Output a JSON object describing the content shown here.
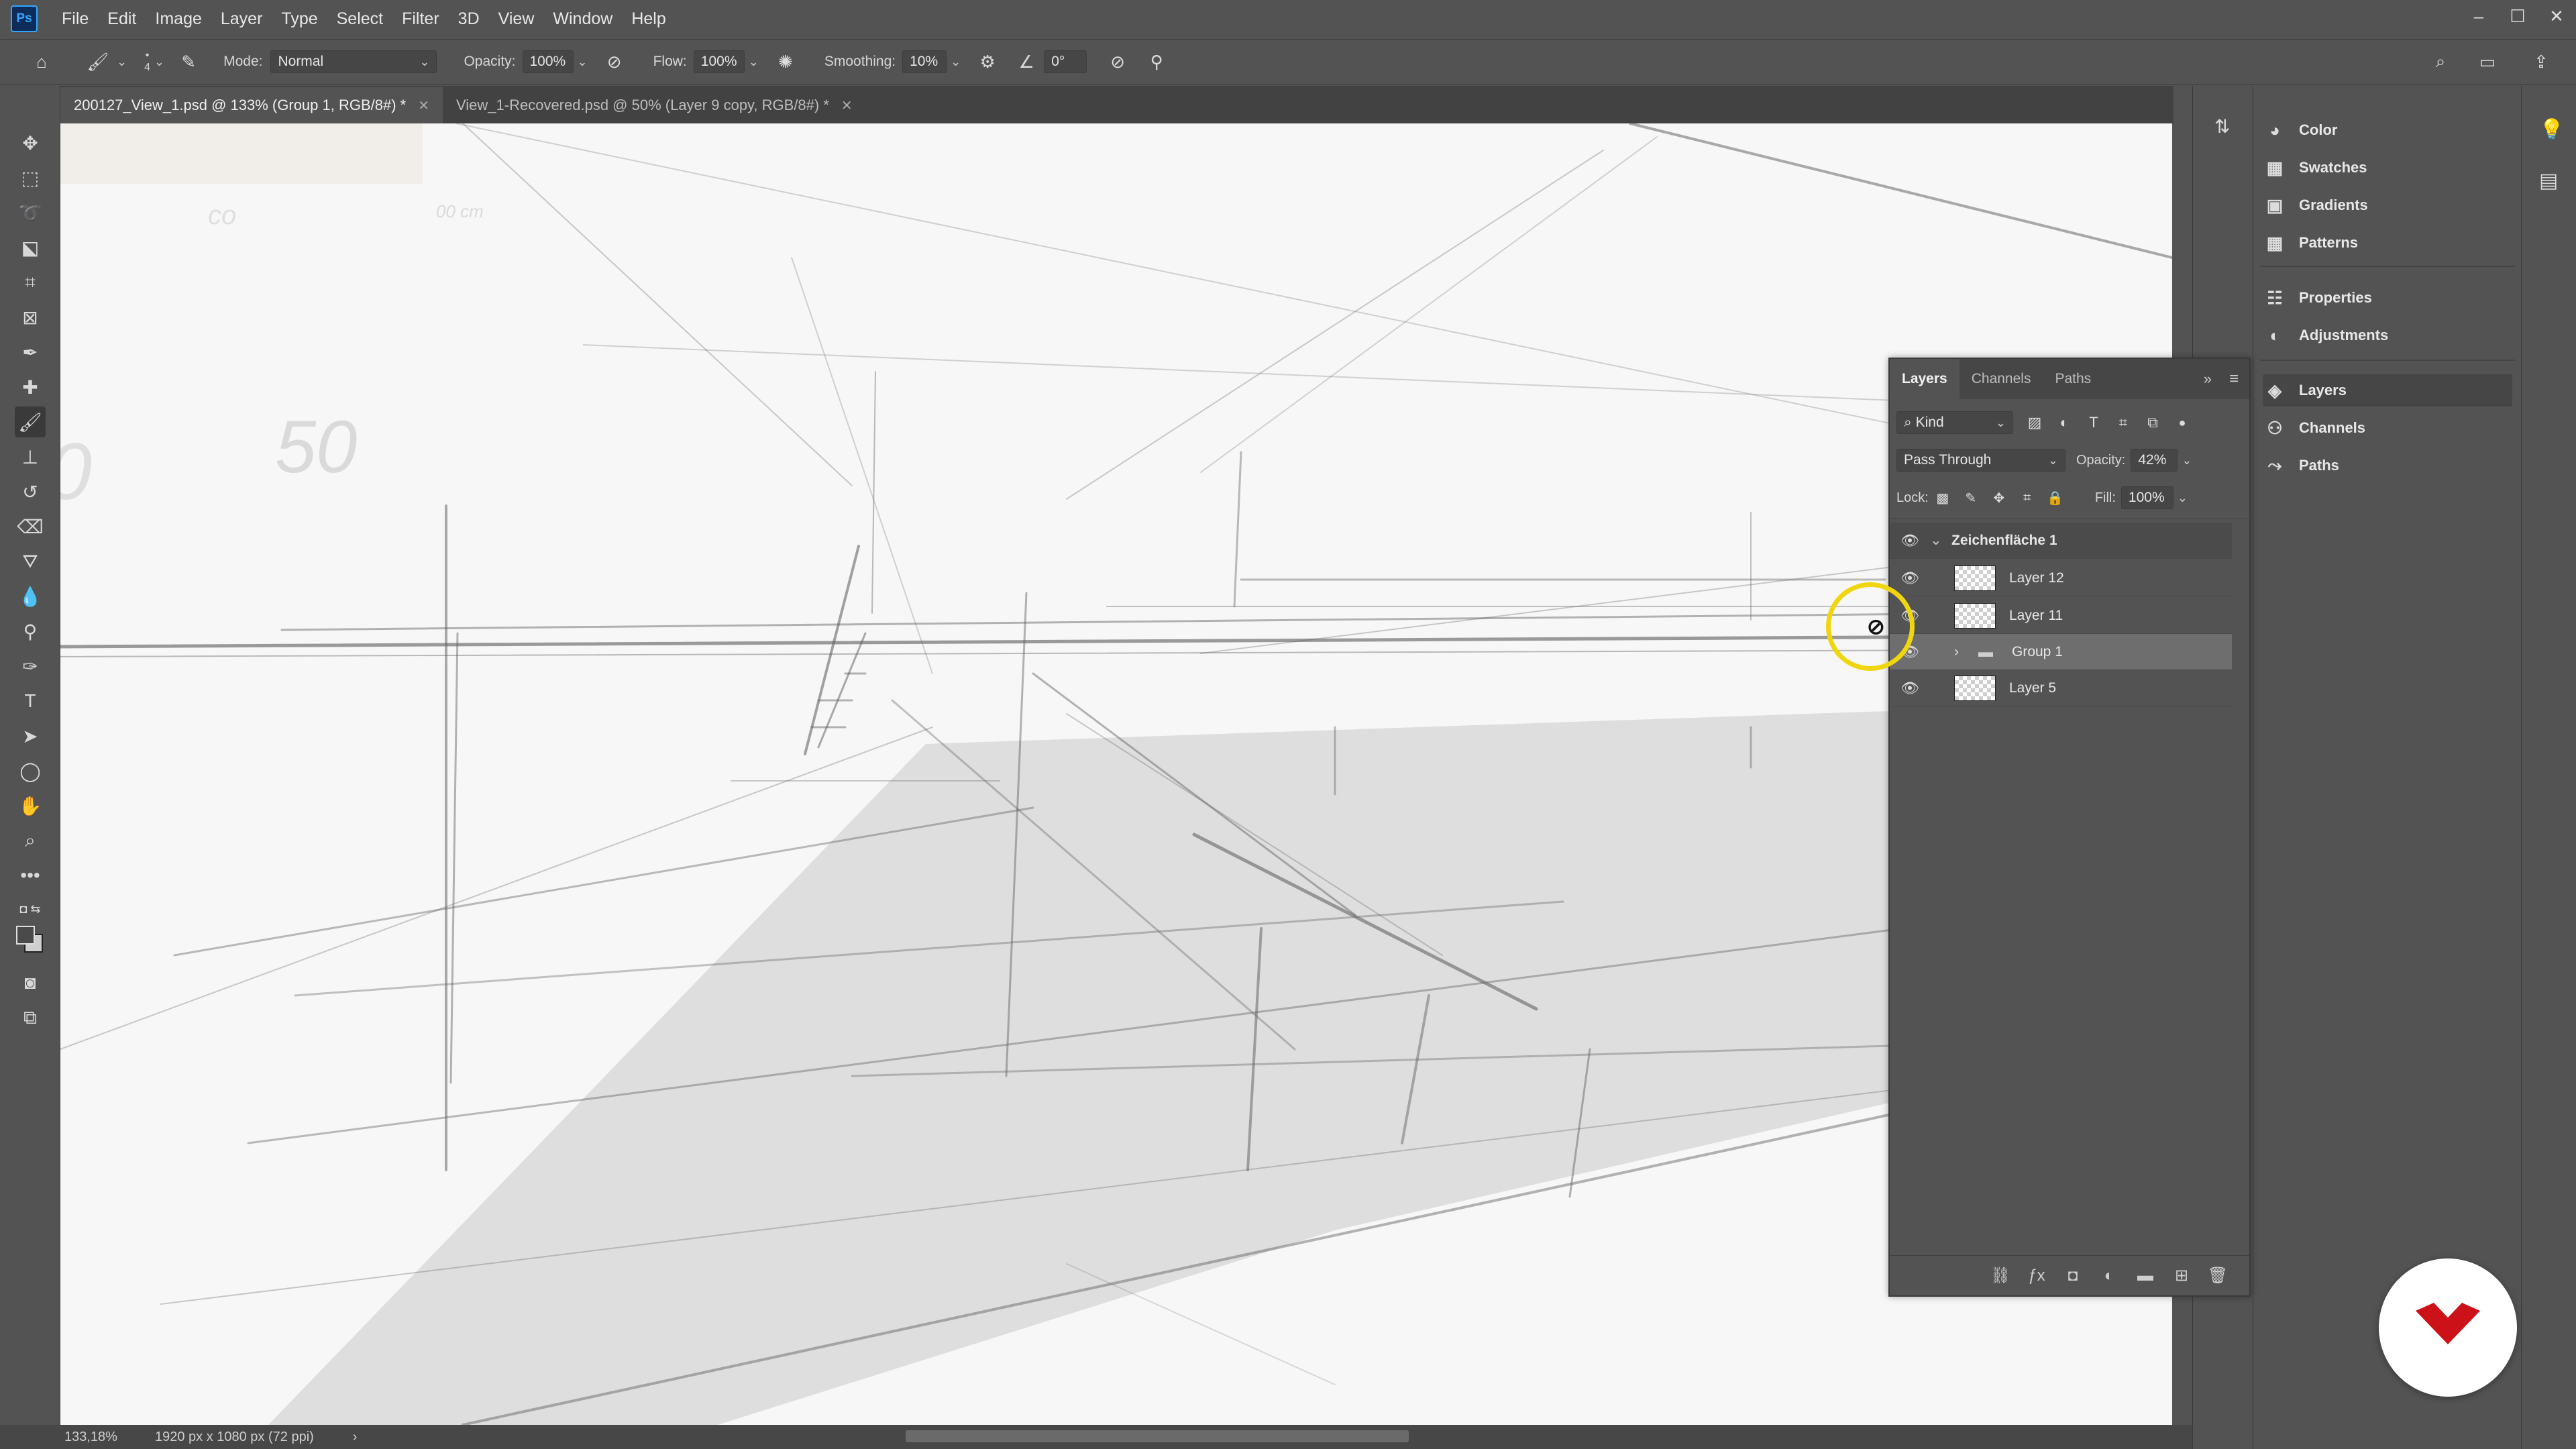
{
  "app": {
    "logo": "Ps",
    "menu": [
      "File",
      "Edit",
      "Image",
      "Layer",
      "Type",
      "Select",
      "Filter",
      "3D",
      "View",
      "Window",
      "Help"
    ],
    "window_controls": [
      "–",
      "☐",
      "✕"
    ]
  },
  "options_bar": {
    "brush_size": "4",
    "mode_label": "Mode:",
    "mode_value": "Normal",
    "opacity_label": "Opacity:",
    "opacity_value": "100%",
    "flow_label": "Flow:",
    "flow_value": "100%",
    "smoothing_label": "Smoothing:",
    "smoothing_value": "10%",
    "angle_value": "0°"
  },
  "tabs": [
    {
      "label": "200127_View_1.psd @ 133% (Group 1, RGB/8#) *",
      "active": true
    },
    {
      "label": "View_1-Recovered.psd @ 50% (Layer 9 copy, RGB/8#) *",
      "active": false
    }
  ],
  "status": {
    "zoom": "133,18%",
    "doc_info": "1920 px x 1080 px (72 ppi)",
    "arrow": "›"
  },
  "dock": {
    "group1": [
      {
        "label": "Color",
        "icon": "color-icon"
      },
      {
        "label": "Swatches",
        "icon": "swatches-icon"
      },
      {
        "label": "Gradients",
        "icon": "gradients-icon"
      },
      {
        "label": "Patterns",
        "icon": "patterns-icon"
      }
    ],
    "group2": [
      {
        "label": "Properties",
        "icon": "properties-icon"
      },
      {
        "label": "Adjustments",
        "icon": "adjustments-icon"
      }
    ],
    "group3": [
      {
        "label": "Layers",
        "icon": "layers-icon",
        "active": true
      },
      {
        "label": "Channels",
        "icon": "channels-icon"
      },
      {
        "label": "Paths",
        "icon": "paths-icon"
      }
    ]
  },
  "layers_panel": {
    "tabs": [
      "Layers",
      "Channels",
      "Paths"
    ],
    "filter_kind": "Kind",
    "blend_mode": "Pass Through",
    "opacity_label": "Opacity:",
    "opacity_value": "42%",
    "lock_label": "Lock:",
    "fill_label": "Fill:",
    "fill_value": "100%",
    "layers": [
      {
        "name": "Zeichenfläche 1",
        "type": "artboard"
      },
      {
        "name": "Layer 12",
        "type": "layer"
      },
      {
        "name": "Layer 11",
        "type": "layer"
      },
      {
        "name": "Group 1",
        "type": "group",
        "selected": true
      },
      {
        "name": "Layer 5",
        "type": "layer"
      }
    ]
  },
  "canvas": {
    "sketch_numbers": [
      "50",
      "0"
    ],
    "faint_text": [
      "00 cm",
      "co"
    ]
  },
  "colors": {
    "ui_bg": "#535353",
    "canvas_bg": "#f7f7f7",
    "cursor_ring": "#f0d60f",
    "badge_red": "#cc1218",
    "ps_blue": "#31a8ff"
  }
}
